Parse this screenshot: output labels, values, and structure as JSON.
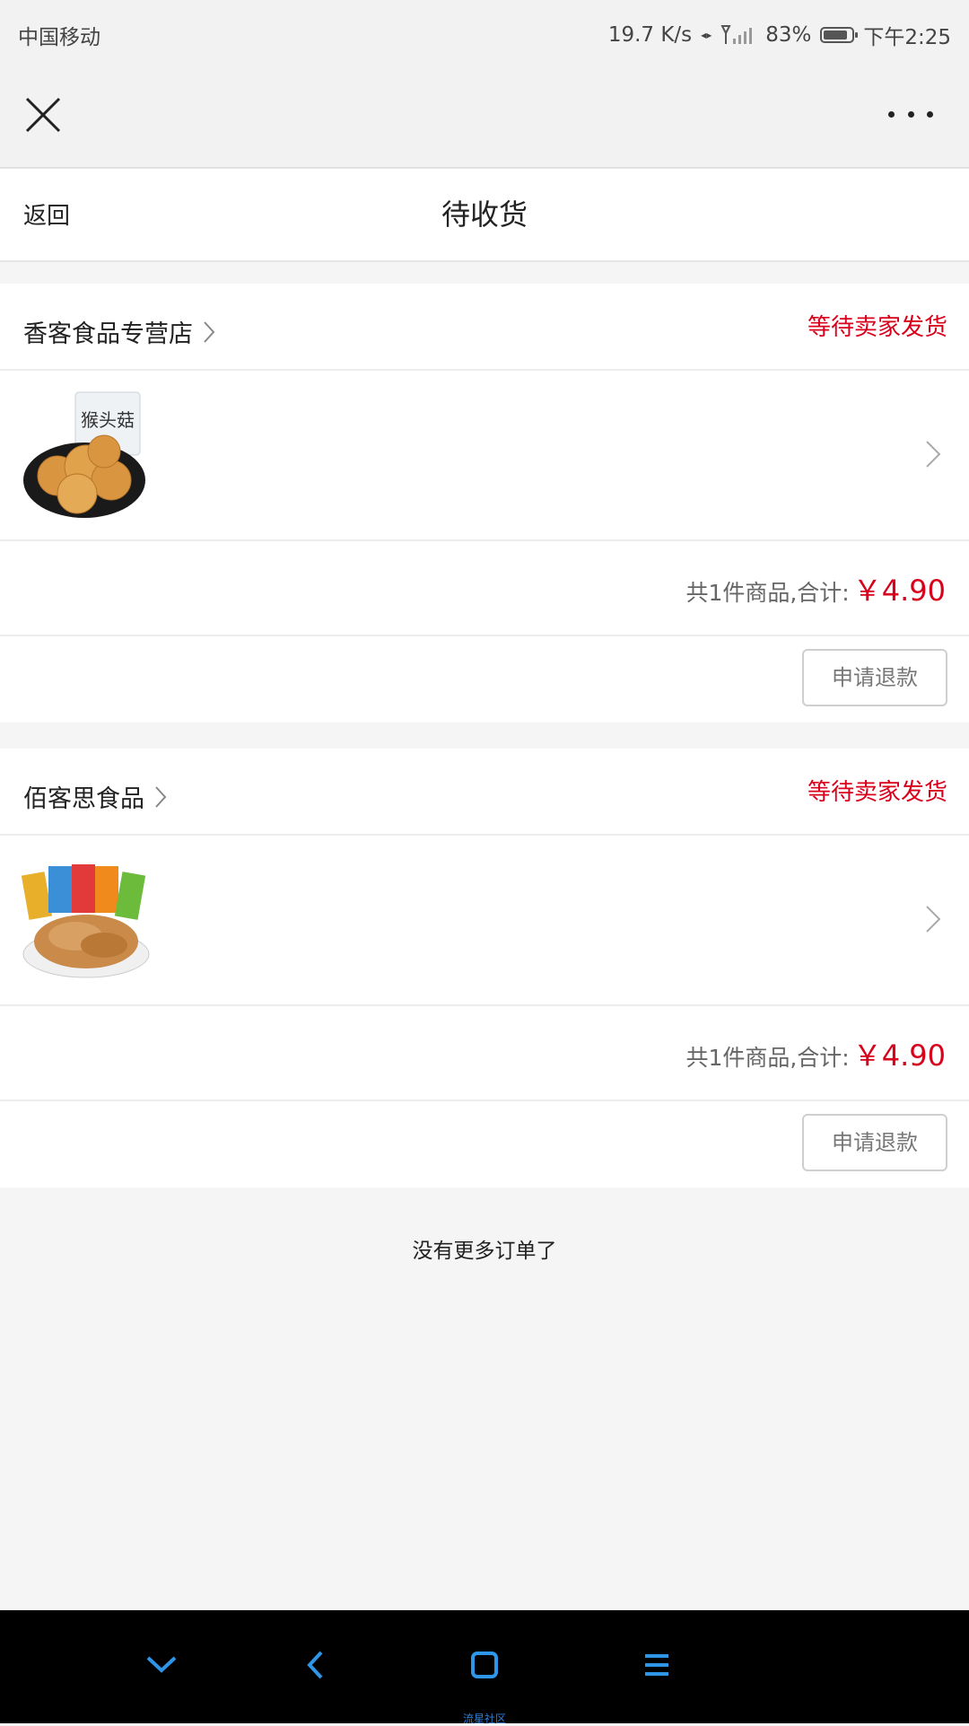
{
  "status_bar": {
    "carrier": "中国移动",
    "network_speed": "19.7 K/s",
    "battery": "83%",
    "time": "下午2:25"
  },
  "header": {
    "back_label": "返回",
    "title": "待收货"
  },
  "orders": [
    {
      "shop_name": "香客食品专营店",
      "status": "等待卖家发货",
      "product_icon": "cookie-product-image",
      "summary_label": "共1件商品,合计:",
      "total": "￥4.90",
      "action_label": "申请退款"
    },
    {
      "shop_name": "佰客思食品",
      "status": "等待卖家发货",
      "product_icon": "pork-floss-product-image",
      "summary_label": "共1件商品,合计:",
      "total": "￥4.90",
      "action_label": "申请退款"
    }
  ],
  "footer": {
    "no_more_text": "没有更多订单了"
  },
  "nav_bar": {
    "watermark": "流星社区"
  },
  "colors": {
    "accent_red": "#d9001b",
    "nav_blue": "#2f95e6"
  }
}
